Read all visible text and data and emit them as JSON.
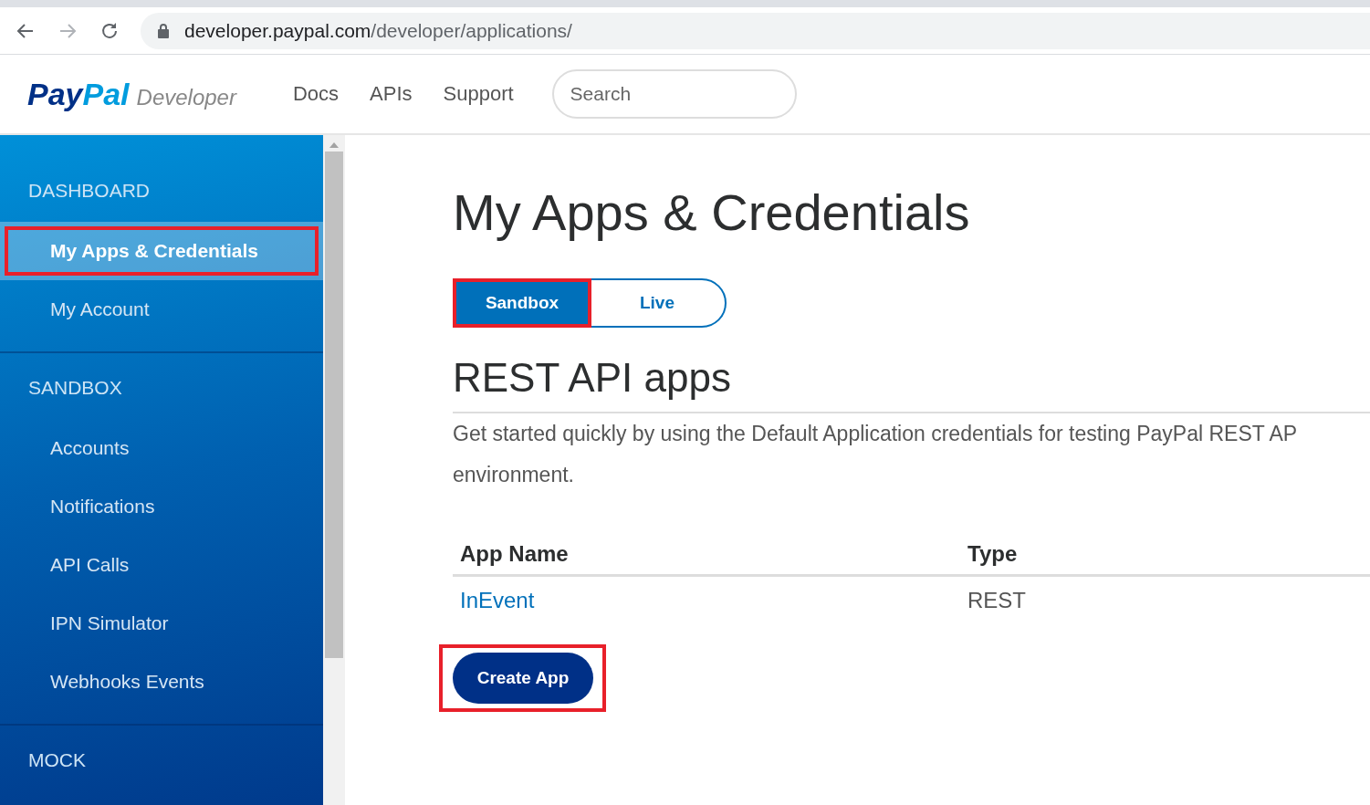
{
  "browser": {
    "url_host": "developer.paypal.com",
    "url_path": "/developer/applications/"
  },
  "header": {
    "logo_pay": "Pay",
    "logo_pal": "Pal",
    "logo_sub": "Developer",
    "nav": [
      "Docs",
      "APIs",
      "Support"
    ],
    "search": {
      "placeholder": "Search"
    }
  },
  "sidebar": {
    "sections": [
      {
        "title": "DASHBOARD",
        "items": [
          {
            "label": "My Apps & Credentials",
            "selected": true,
            "highlighted": true
          },
          {
            "label": "My Account",
            "selected": false,
            "highlighted": false
          }
        ]
      },
      {
        "title": "SANDBOX",
        "items": [
          {
            "label": "Accounts",
            "selected": false,
            "highlighted": false
          },
          {
            "label": "Notifications",
            "selected": false,
            "highlighted": false
          },
          {
            "label": "API Calls",
            "selected": false,
            "highlighted": false
          },
          {
            "label": "IPN Simulator",
            "selected": false,
            "highlighted": false
          },
          {
            "label": "Webhooks Events",
            "selected": false,
            "highlighted": false
          }
        ]
      },
      {
        "title": "MOCK"
      }
    ]
  },
  "main": {
    "title": "My Apps & Credentials",
    "tabs": [
      {
        "label": "Sandbox",
        "selected": true,
        "highlighted": true
      },
      {
        "label": "Live",
        "selected": false,
        "highlighted": false
      }
    ],
    "section_title": "REST API apps",
    "description": [
      "Get started quickly by using the Default Application credentials for testing PayPal REST AP",
      "environment."
    ],
    "table": {
      "columns": [
        "App Name",
        "Type"
      ],
      "rows": [
        {
          "app_name": "InEvent",
          "type": "REST"
        }
      ]
    },
    "create_button": {
      "label": "Create App",
      "highlighted": true
    }
  }
}
